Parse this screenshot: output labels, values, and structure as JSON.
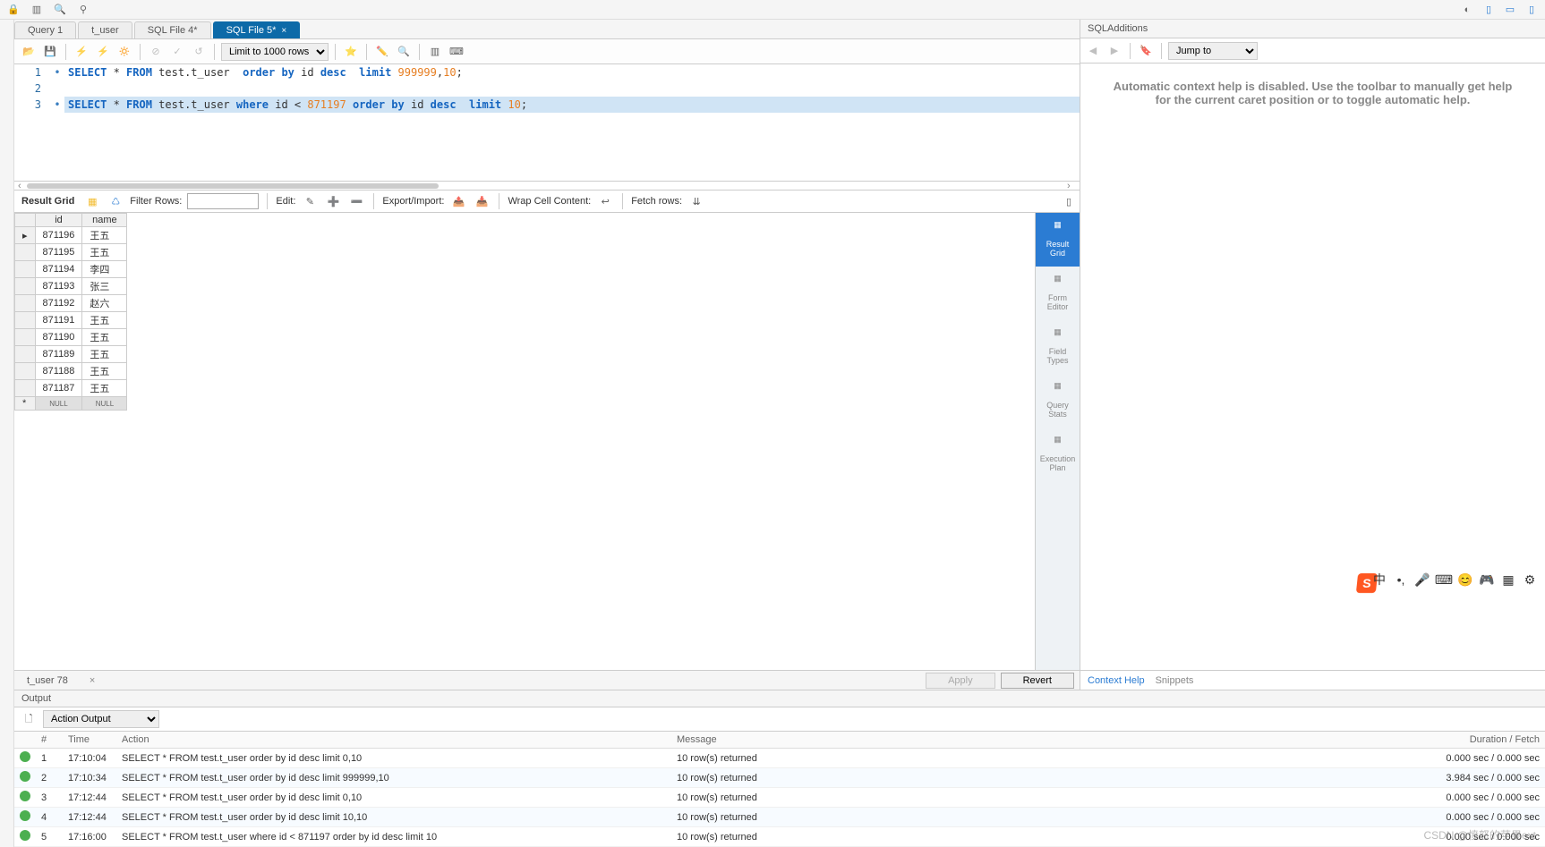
{
  "topbar_right_icon": "◐",
  "tabs": [
    {
      "label": "Query 1"
    },
    {
      "label": "t_user"
    },
    {
      "label": "SQL File 4*"
    },
    {
      "label": "SQL File 5*",
      "active": true
    }
  ],
  "editor_toolbar": {
    "limit": "Limit to 1000 rows"
  },
  "sql_lines": [
    {
      "n": 1,
      "bp": "•",
      "tokens": [
        {
          "t": "SELECT",
          "c": "kw"
        },
        {
          "t": " * "
        },
        {
          "t": "FROM",
          "c": "kw"
        },
        {
          "t": " test.t_user  "
        },
        {
          "t": "order by",
          "c": "kw"
        },
        {
          "t": " id "
        },
        {
          "t": "desc",
          "c": "kw"
        },
        {
          "t": "  "
        },
        {
          "t": "limit",
          "c": "kw"
        },
        {
          "t": " "
        },
        {
          "t": "999999",
          "c": "num"
        },
        {
          "t": ","
        },
        {
          "t": "10",
          "c": "num"
        },
        {
          "t": ";"
        }
      ]
    },
    {
      "n": 2,
      "bp": "",
      "tokens": []
    },
    {
      "n": 3,
      "bp": "•",
      "sel": true,
      "tokens": [
        {
          "t": "SELECT",
          "c": "kw"
        },
        {
          "t": " * "
        },
        {
          "t": "FROM",
          "c": "kw"
        },
        {
          "t": " test.t_user "
        },
        {
          "t": "where",
          "c": "kw"
        },
        {
          "t": " id < "
        },
        {
          "t": "871197",
          "c": "num"
        },
        {
          "t": " "
        },
        {
          "t": "order by",
          "c": "kw"
        },
        {
          "t": " id "
        },
        {
          "t": "desc",
          "c": "kw"
        },
        {
          "t": "  "
        },
        {
          "t": "limit",
          "c": "kw"
        },
        {
          "t": " "
        },
        {
          "t": "10",
          "c": "num"
        },
        {
          "t": ";"
        }
      ]
    }
  ],
  "result_toolbar": {
    "title": "Result Grid",
    "filter_label": "Filter Rows:",
    "edit_label": "Edit:",
    "export_label": "Export/Import:",
    "wrap_label": "Wrap Cell Content:",
    "fetch_label": "Fetch rows:"
  },
  "grid": {
    "cols": [
      "id",
      "name"
    ],
    "rows": [
      [
        "871196",
        "王五"
      ],
      [
        "871195",
        "王五"
      ],
      [
        "871194",
        "李四"
      ],
      [
        "871193",
        "张三"
      ],
      [
        "871192",
        "赵六"
      ],
      [
        "871191",
        "王五"
      ],
      [
        "871190",
        "王五"
      ],
      [
        "871189",
        "王五"
      ],
      [
        "871188",
        "王五"
      ],
      [
        "871187",
        "王五"
      ]
    ],
    "null_label": "NULL"
  },
  "side_tabs": [
    {
      "label": "Result\nGrid",
      "active": true
    },
    {
      "label": "Form\nEditor"
    },
    {
      "label": "Field\nTypes"
    },
    {
      "label": "Query\nStats"
    },
    {
      "label": "Execution\nPlan"
    }
  ],
  "footer": {
    "tab_label": "t_user 78",
    "apply": "Apply",
    "revert": "Revert"
  },
  "sql_additions": {
    "title": "SQLAdditions",
    "jump": "Jump to",
    "help_text": "Automatic context help is disabled. Use the toolbar to manually get help for the current caret position or to toggle automatic help.",
    "tabs": [
      "Context Help",
      "Snippets"
    ]
  },
  "output": {
    "title": "Output",
    "dropdown": "Action Output",
    "headers": [
      "",
      "#",
      "Time",
      "Action",
      "Message",
      "Duration / Fetch"
    ],
    "rows": [
      {
        "n": "1",
        "time": "17:10:04",
        "action": "SELECT * FROM test.t_user  order by id desc  limit 0,10",
        "msg": "10 row(s) returned",
        "dur": "0.000 sec / 0.000 sec"
      },
      {
        "n": "2",
        "time": "17:10:34",
        "action": "SELECT * FROM test.t_user  order by id desc  limit 999999,10",
        "msg": "10 row(s) returned",
        "dur": "3.984 sec / 0.000 sec"
      },
      {
        "n": "3",
        "time": "17:12:44",
        "action": "SELECT * FROM test.t_user  order by id desc  limit 0,10",
        "msg": "10 row(s) returned",
        "dur": "0.000 sec / 0.000 sec"
      },
      {
        "n": "4",
        "time": "17:12:44",
        "action": "SELECT * FROM test.t_user  order by id desc  limit 10,10",
        "msg": "10 row(s) returned",
        "dur": "0.000 sec / 0.000 sec"
      },
      {
        "n": "5",
        "time": "17:16:00",
        "action": "SELECT * FROM test.t_user where id < 871197 order by id desc  limit 10",
        "msg": "10 row(s) returned",
        "dur": "0.000 sec / 0.000 sec"
      }
    ]
  },
  "watermark": "CSDN @愤怒的苹果ext",
  "sogou": "S"
}
